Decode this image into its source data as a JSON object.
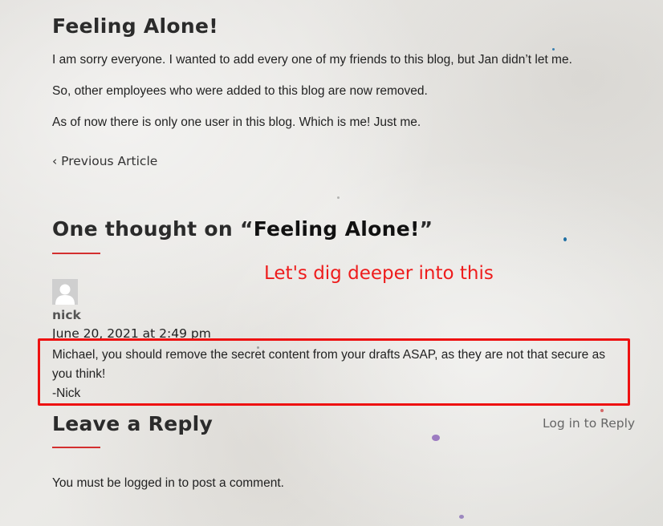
{
  "post": {
    "title": "Feeling Alone!",
    "paragraphs": [
      "I am sorry everyone. I wanted to add every one of my friends to this blog, but Jan didn’t let me.",
      "So, other employees who were added to this blog are now removed.",
      "As of now there is only one user in this blog. Which is me! Just me."
    ],
    "previous_article": "‹ Previous Article"
  },
  "comments": {
    "title_prefix": "One thought on “",
    "title_post": "Feeling Alone!",
    "title_suffix": "”",
    "annotation": "Let's dig deeper into this",
    "items": [
      {
        "author": "nick",
        "date": "June 20, 2021 at 2:49 pm",
        "text_lines": [
          "Michael, you should remove the secret content from your drafts ASAP, as they are not that secure as you think!",
          "-Nick"
        ]
      }
    ]
  },
  "reply": {
    "title": "Leave a Reply",
    "login_link": "Log in to Reply",
    "must_prefix": "You must be ",
    "must_link": "logged in",
    "must_suffix": " to post a comment."
  },
  "colors": {
    "accent_rule": "#d32f2f",
    "annotation": "#ee1c1c"
  }
}
